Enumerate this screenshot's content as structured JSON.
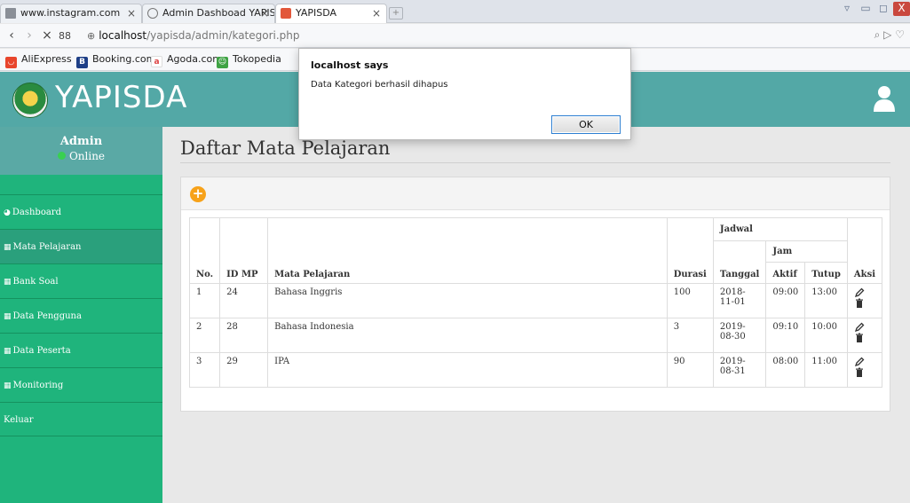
{
  "browser": {
    "tabs": [
      {
        "label": "www.instagram.com",
        "close": "×"
      },
      {
        "label": "Admin Dashboad YAPISD/",
        "close": "×"
      },
      {
        "label": "YAPISDA",
        "close": "×"
      }
    ],
    "url_host": "localhost",
    "url_path": "/yapisda/admin/kategori.php",
    "nav": {
      "back": "‹",
      "forward": "›",
      "stop": "×",
      "apps": "88"
    },
    "bookmarks": [
      "AliExpress",
      "Booking.com",
      "Agoda.com",
      "Tokopedia"
    ],
    "window_controls": {
      "min": "▭",
      "max": "◻",
      "close": "X"
    }
  },
  "header": {
    "brand": "YAPISDA"
  },
  "sidebar": {
    "admin_name": "Admin",
    "status": "Online",
    "items": [
      {
        "label": "Dashboard",
        "icon": "dashboard-icon"
      },
      {
        "label": "Mata Pelajaran",
        "icon": "table-icon"
      },
      {
        "label": "Bank Soal",
        "icon": "table-icon"
      },
      {
        "label": "Data Pengguna",
        "icon": "table-icon"
      },
      {
        "label": "Data Peserta",
        "icon": "table-icon"
      },
      {
        "label": "Monitoring",
        "icon": "table-icon"
      },
      {
        "label": "Keluar",
        "icon": ""
      }
    ],
    "active_index": 1
  },
  "main": {
    "title": "Daftar Mata Pelajaran",
    "add_button": "+",
    "table": {
      "headers": {
        "no": "No.",
        "id": "ID MP",
        "mapel": "Mata Pelajaran",
        "durasi": "Durasi",
        "jadwal": "Jadwal",
        "tanggal": "Tanggal",
        "jam": "Jam",
        "aktif": "Aktif",
        "tutup": "Tutup",
        "aksi": "Aksi"
      },
      "rows": [
        {
          "no": "1",
          "id": "24",
          "mapel": "Bahasa Inggris",
          "durasi": "100",
          "tanggal": "2018-11-01",
          "aktif": "09:00",
          "tutup": "13:00"
        },
        {
          "no": "2",
          "id": "28",
          "mapel": "Bahasa Indonesia",
          "durasi": "3",
          "tanggal": "2019-08-30",
          "aktif": "09:10",
          "tutup": "10:00"
        },
        {
          "no": "3",
          "id": "29",
          "mapel": "IPA",
          "durasi": "90",
          "tanggal": "2019-08-31",
          "aktif": "08:00",
          "tutup": "11:00"
        }
      ]
    }
  },
  "dialog": {
    "title": "localhost says",
    "message": "Data Kategori berhasil dihapus",
    "ok_label": "OK"
  },
  "colors": {
    "header": "#53a8a6",
    "sidebar": "#1fb47c",
    "add_button": "#f7a21a"
  }
}
